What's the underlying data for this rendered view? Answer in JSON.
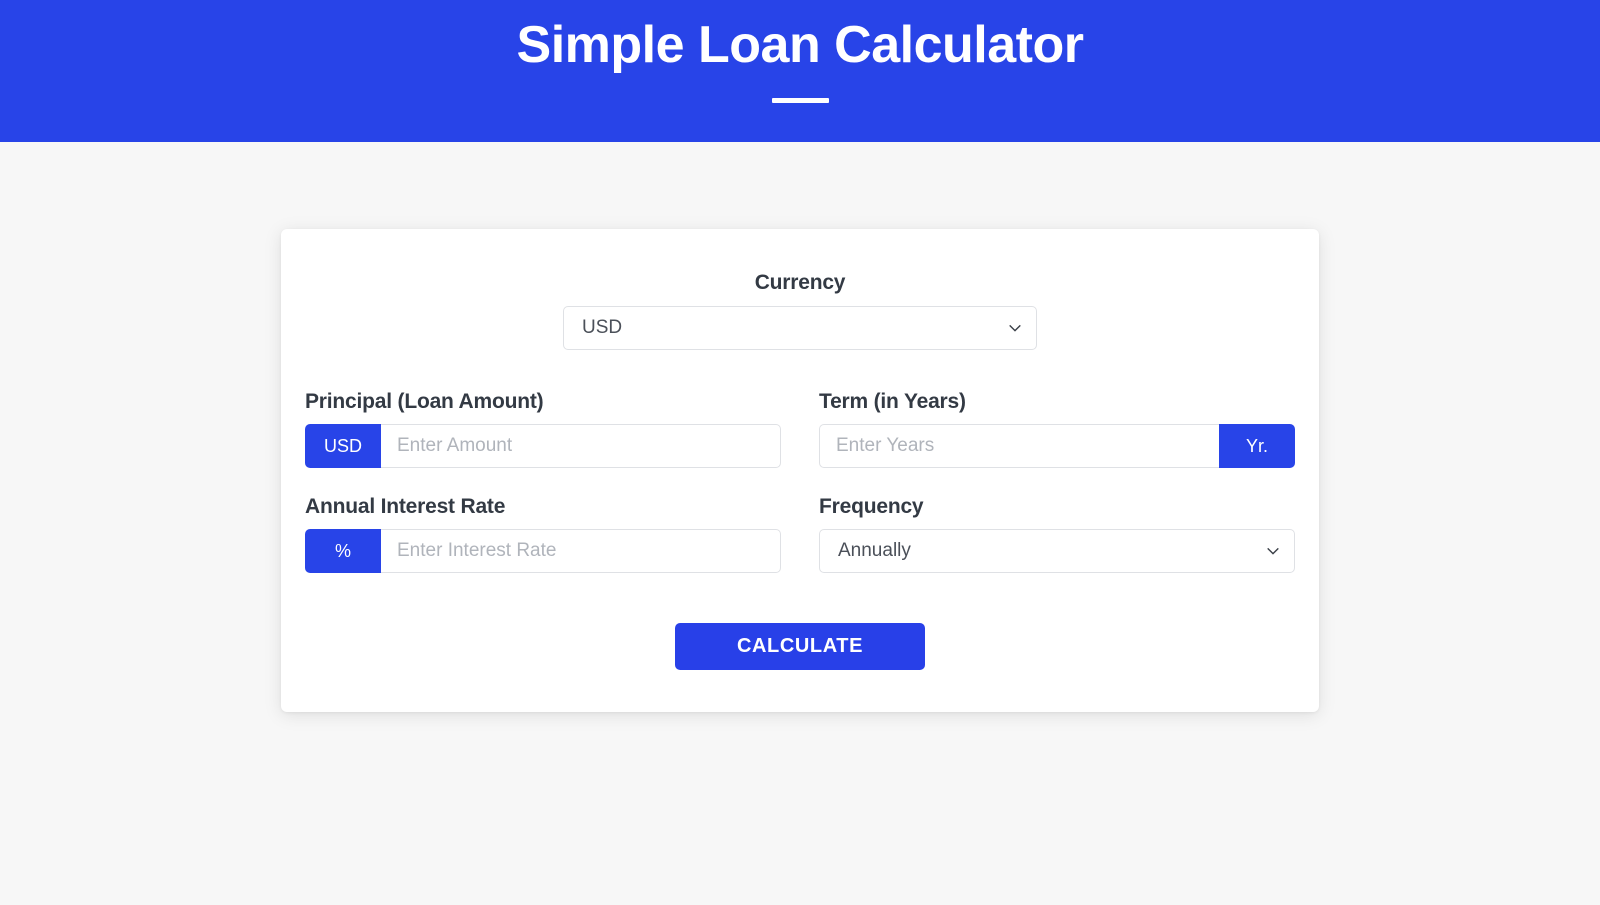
{
  "header": {
    "title": "Simple Loan Calculator"
  },
  "form": {
    "currency": {
      "label": "Currency",
      "value": "USD",
      "icon": "chevron-down-icon"
    },
    "principal": {
      "label": "Principal (Loan Amount)",
      "addon": "USD",
      "value": "",
      "placeholder": "Enter Amount"
    },
    "term": {
      "label": "Term (in Years)",
      "addon": "Yr.",
      "value": "",
      "placeholder": "Enter Years"
    },
    "interest": {
      "label": "Annual Interest Rate",
      "addon": "%",
      "value": "",
      "placeholder": "Enter Interest Rate"
    },
    "frequency": {
      "label": "Frequency",
      "value": "Annually",
      "icon": "chevron-down-icon"
    },
    "submit": {
      "label": "CALCULATE"
    }
  },
  "colors": {
    "brand_blue": "#2844e8",
    "page_background": "#f7f7f7",
    "card_background": "#ffffff",
    "label_text": "#333a44",
    "placeholder_text": "#b0b4bb"
  }
}
